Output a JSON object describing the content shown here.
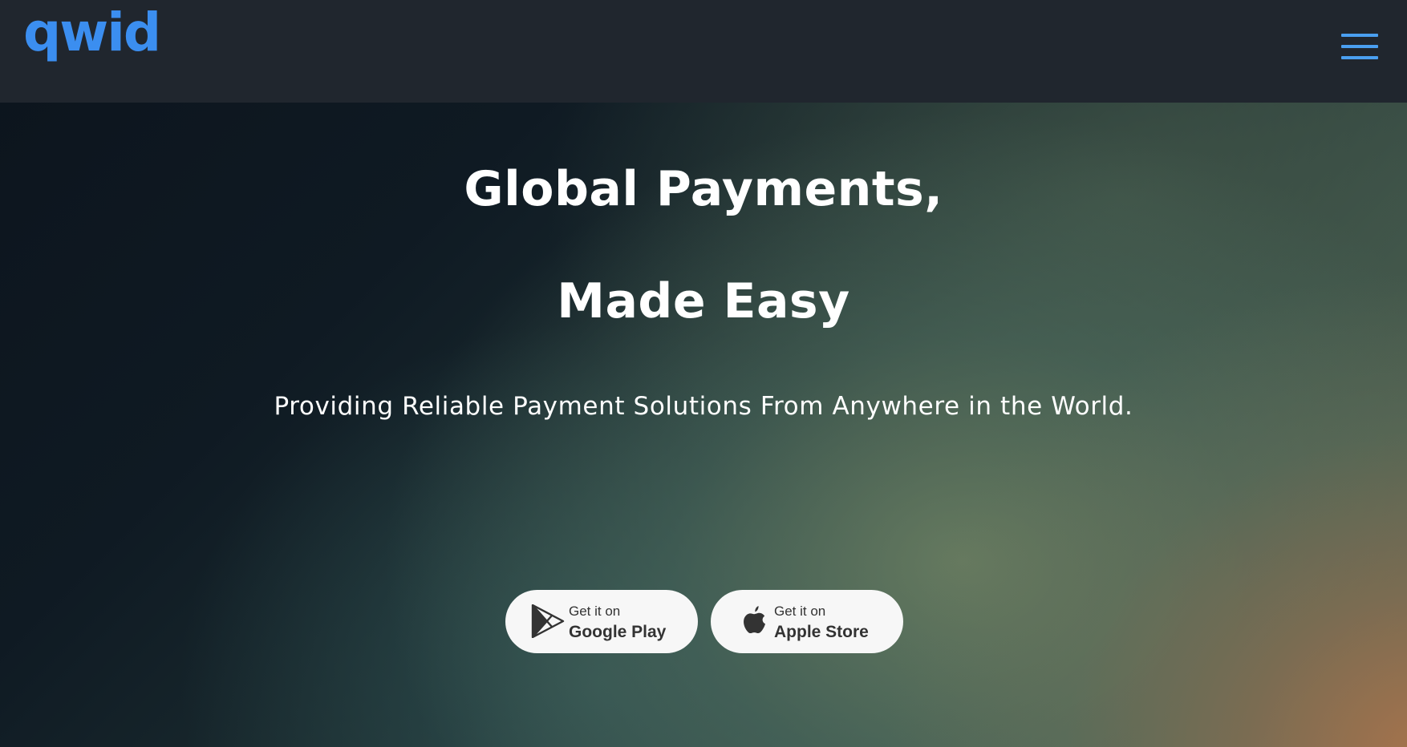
{
  "header": {
    "logo_text": "qwid",
    "menu_icon": "hamburger-menu-icon"
  },
  "hero": {
    "title_line1": "Global Payments,",
    "title_line2": "Made Easy",
    "subtitle": "Providing Reliable Payment Solutions From Anywhere in the World."
  },
  "store_buttons": [
    {
      "small": "Get it on",
      "big": "Google Play",
      "icon": "google-play-icon"
    },
    {
      "small": "Get it on",
      "big": "Apple Store",
      "icon": "apple-icon"
    }
  ],
  "colors": {
    "logo": "#3b8ef0",
    "menu_icon": "#4a9ff0",
    "header_bg": "#20262e",
    "button_bg": "#f7f7f7"
  }
}
